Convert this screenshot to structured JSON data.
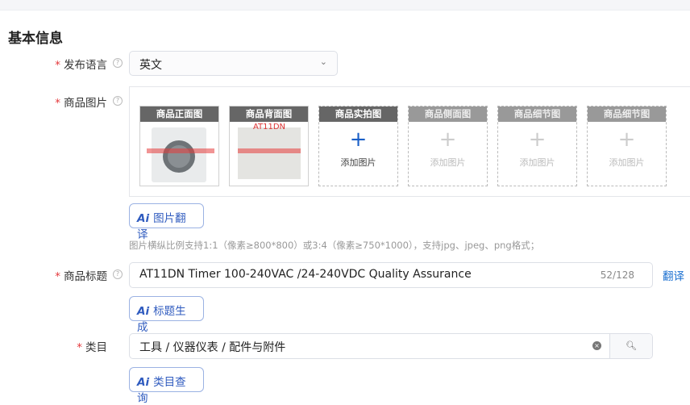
{
  "section_title": "基本信息",
  "language": {
    "label": "发布语言",
    "value": "英文"
  },
  "images": {
    "label": "商品图片",
    "slots": [
      {
        "title": "商品正面图",
        "filled": true
      },
      {
        "title": "商品背面图",
        "filled": true,
        "caption": "AT11DN"
      },
      {
        "title": "商品实拍图",
        "filled": false,
        "add_label": "添加图片",
        "enabled": true
      },
      {
        "title": "商品侧面图",
        "filled": false,
        "add_label": "添加图片",
        "enabled": false
      },
      {
        "title": "商品细节图",
        "filled": false,
        "add_label": "添加图片",
        "enabled": false
      },
      {
        "title": "商品细节图",
        "filled": false,
        "add_label": "添加图片",
        "enabled": false
      }
    ],
    "ai_button": "图片翻译",
    "hint": "图片横纵比例支持1:1（像素≥800*800）或3:4（像素≥750*1000），支持jpg、jpeg、png格式；"
  },
  "product_title": {
    "label": "商品标题",
    "value": "AT11DN Timer 100-240VAC /24-240VDC Quality Assurance",
    "count": "52/128",
    "translate": "翻译",
    "ai_button": "标题生成"
  },
  "category": {
    "label": "类目",
    "value": "工具 / 仪器仪表 / 配件与附件",
    "ai_button": "类目查询"
  },
  "ai_prefix": "Ai",
  "colors": {
    "accent": "#2f5bbf",
    "required": "#e4393c",
    "link": "#1a6fd0"
  }
}
